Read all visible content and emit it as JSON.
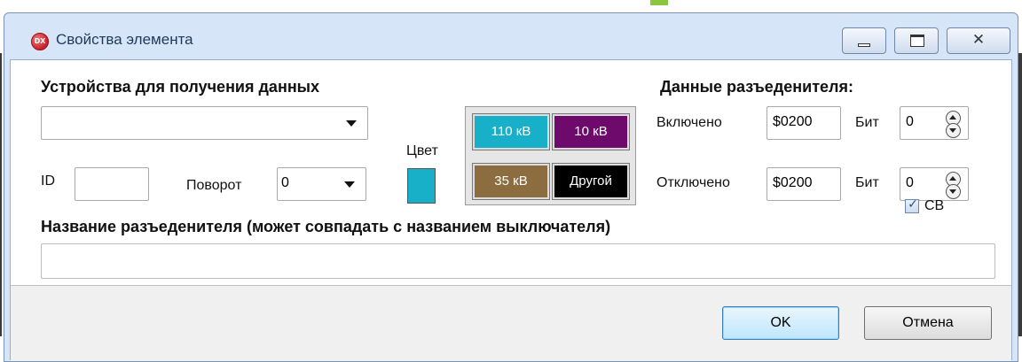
{
  "window": {
    "title": "Свойства элемента",
    "app_icon_text": "DX",
    "close_glyph": "✕"
  },
  "devices": {
    "heading": "Устройства для получения данных",
    "selected": ""
  },
  "id_field": {
    "label": "ID",
    "value": ""
  },
  "rotation": {
    "label": "Поворот",
    "selected": "0"
  },
  "color": {
    "label": "Цвет",
    "current": "#17b0c8",
    "palette": [
      {
        "label": "110 кВ",
        "color": "#17b0c8"
      },
      {
        "label": "10 кВ",
        "color": "#6e0a6c"
      },
      {
        "label": "35 кВ",
        "color": "#8c6d3f"
      },
      {
        "label": "Другой",
        "color": "#000000"
      }
    ]
  },
  "disconnector_data": {
    "heading": "Данные разъеденителя:",
    "on": {
      "label": "Включено",
      "address": "$0200",
      "bit_label": "Бит",
      "bit": "0"
    },
    "off": {
      "label": "Отключено",
      "address": "$0200",
      "bit_label": "Бит",
      "bit": "0"
    }
  },
  "name_section": {
    "heading": "Название разъеденителя (может совпадать с названием выключателя)",
    "value": ""
  },
  "cb_checkbox": {
    "label": "CB",
    "checked": true
  },
  "buttons": {
    "ok": "OK",
    "cancel": "Отмена"
  }
}
